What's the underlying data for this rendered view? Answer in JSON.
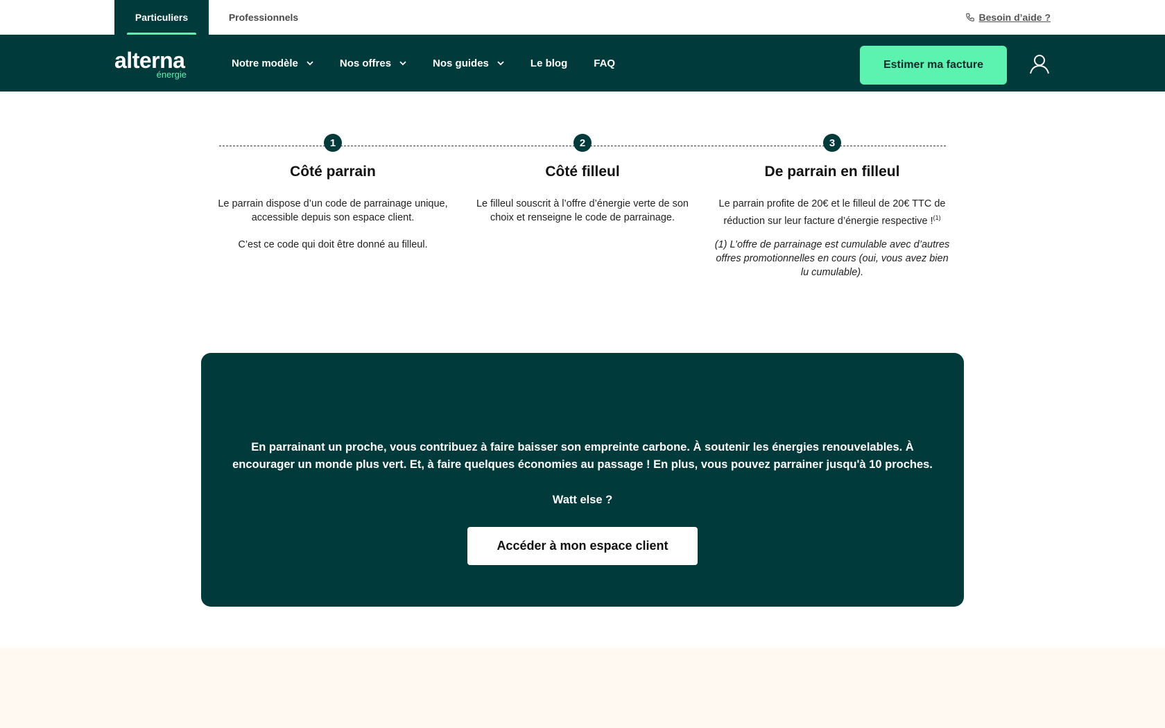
{
  "topbar": {
    "tabs": [
      {
        "label": "Particuliers",
        "active": true
      },
      {
        "label": "Professionnels",
        "active": false
      }
    ],
    "help_label": "Besoin d’aide ?",
    "help_icon": "phone-icon"
  },
  "nav": {
    "logo_word": "alterna",
    "logo_sub": "énergie",
    "items": [
      {
        "label": "Notre modèle",
        "has_dropdown": true
      },
      {
        "label": "Nos offres",
        "has_dropdown": true
      },
      {
        "label": "Nos guides",
        "has_dropdown": true
      },
      {
        "label": "Le blog",
        "has_dropdown": false
      },
      {
        "label": "FAQ",
        "has_dropdown": false
      }
    ],
    "cta_label": "Estimer ma facture",
    "account_icon": "user-icon"
  },
  "steps": [
    {
      "number": "1",
      "title": "Côté parrain",
      "paragraphs": [
        "Le parrain dispose d’un code de parrainage unique, accessible depuis son espace client.",
        "C’est ce code qui doit être donné au filleul."
      ]
    },
    {
      "number": "2",
      "title": "Côté filleul",
      "paragraphs": [
        "Le filleul souscrit à l’offre d’énergie verte de son choix et renseigne le code de parrainage."
      ]
    },
    {
      "number": "3",
      "title": "De parrain en filleul",
      "paragraphs": [
        "Le parrain profite de 20€ et le filleul de 20€ TTC de réduction sur leur facture d’énergie respective !"
      ],
      "footnote_marker": "(1)",
      "note": "(1) L’offre de parrainage est cumulable avec d’autres offres promotionnelles en cours (oui, vous avez bien lu cumulable)."
    }
  ],
  "card": {
    "text": "En parrainant un proche, vous contribuez à faire baisser son empreinte carbone. À soutenir les énergies renouvelables. À encourager un monde plus vert. Et, à faire quelques économies au passage ! En plus, vous pouvez parrainer jusqu'à 10 proches.",
    "sub": "Watt else ?",
    "button_label": "Accéder à mon espace client"
  },
  "colors": {
    "brand_dark": "#003a3a",
    "accent_green": "#5cf2b0",
    "bottom_band": "#fff9f2"
  }
}
